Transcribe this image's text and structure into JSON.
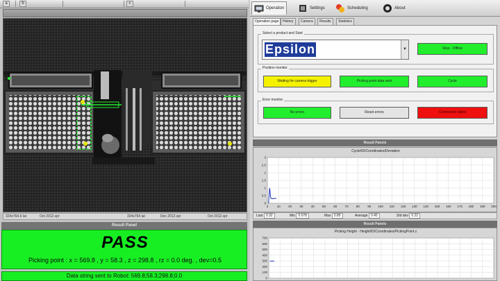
{
  "toolbar": {
    "buttons": [
      "a",
      "b",
      "c"
    ]
  },
  "camera_status": [
    "324x764.6 lat",
    "Oct 2012.xpr",
    "324x764 lat",
    "Dec 2012.xpr",
    "Oct 2012.xpr"
  ],
  "result": {
    "header": "Result Panel",
    "status": "PASS",
    "picking_point": "Picking point : x = 569.8 , y = 58.3 , z = 298.8 , rz = 0.0 deg. , dev=0.5",
    "data_sent": "Data string sent to Robot: 569.8;58.3;298.8;0.0"
  },
  "tabs": [
    {
      "label": "Operation",
      "icon": "operation-icon",
      "active": true
    },
    {
      "label": "Settings",
      "icon": "settings-icon",
      "active": false
    },
    {
      "label": "Scheduling",
      "icon": "scheduling-icon",
      "active": false
    },
    {
      "label": "About",
      "icon": "about-icon",
      "active": false
    }
  ],
  "subtabs": [
    {
      "label": "Operation page",
      "active": true
    },
    {
      "label": "History",
      "active": false
    },
    {
      "label": "Camera",
      "active": false
    },
    {
      "label": "Results",
      "active": false
    },
    {
      "label": "Statistics",
      "active": false
    }
  ],
  "operation": {
    "product_group_title": "Select a product and Start",
    "product_value": "Epsilon",
    "start_button": "Stop - Offline",
    "position_group_title": "Position monitor",
    "waiting_button": "Waiting for camera trigger",
    "picking_button": "Picking point data sent",
    "cycle_button": "Cycle",
    "error_group_title": "Error monitor",
    "no_errors_button": "No errors",
    "reset_button": "Reset errors",
    "error_button": "Connection failed"
  },
  "chart1": {
    "header": "Result Panels",
    "title": "Cycle/ID/Coordinates/Deviation",
    "stats": [
      {
        "label": "Last",
        "value": "0.32"
      },
      {
        "label": "Min",
        "value": "0.078"
      },
      {
        "label": "Max",
        "value": "0.85"
      },
      {
        "label": "Average",
        "value": "0.45"
      },
      {
        "label": "Std dev",
        "value": "0.22"
      }
    ]
  },
  "chart2": {
    "header": "Result Panels",
    "title": "Picking Height - Height/ID/Coordinates/PickingPoint z"
  },
  "chart_data": [
    {
      "type": "line",
      "title": "Cycle/ID/Coordinates/Deviation",
      "x": [
        1,
        2,
        3,
        4,
        5,
        6,
        7,
        8
      ],
      "series": [
        {
          "values": [
            0,
            1.0,
            0.35,
            0.3,
            0.32,
            0.31,
            0.32,
            0.32
          ]
        }
      ],
      "xlim": [
        0,
        200
      ],
      "ylim": [
        0,
        3
      ],
      "xticks": [
        "0",
        "10",
        "20",
        "30",
        "40",
        "50",
        "60",
        "70",
        "80",
        "90",
        "100",
        "110",
        "120",
        "130",
        "140",
        "150",
        "160",
        "170",
        "180",
        "190",
        "200"
      ],
      "yticks": [
        "0",
        "0.5",
        "1",
        "1.5",
        "2",
        "2.5",
        "3"
      ],
      "grid": true
    },
    {
      "type": "line",
      "title": "Picking Height - Height/ID/Coordinates/PickingPoint z",
      "x": [
        1,
        2,
        3,
        4,
        5
      ],
      "series": [
        {
          "values": [
            298,
            298,
            298,
            298,
            298
          ]
        }
      ],
      "xlim": [
        0,
        200
      ],
      "ylim": [
        0,
        700
      ],
      "yticks": [
        "0",
        "100",
        "200",
        "300",
        "400",
        "500",
        "600",
        "700"
      ],
      "grid": true
    }
  ],
  "colors": {
    "pass": "#18ef23",
    "warn": "#f4f200",
    "error": "#ef1010",
    "header": "#6f6f6f",
    "line": "#1a2fb0"
  }
}
